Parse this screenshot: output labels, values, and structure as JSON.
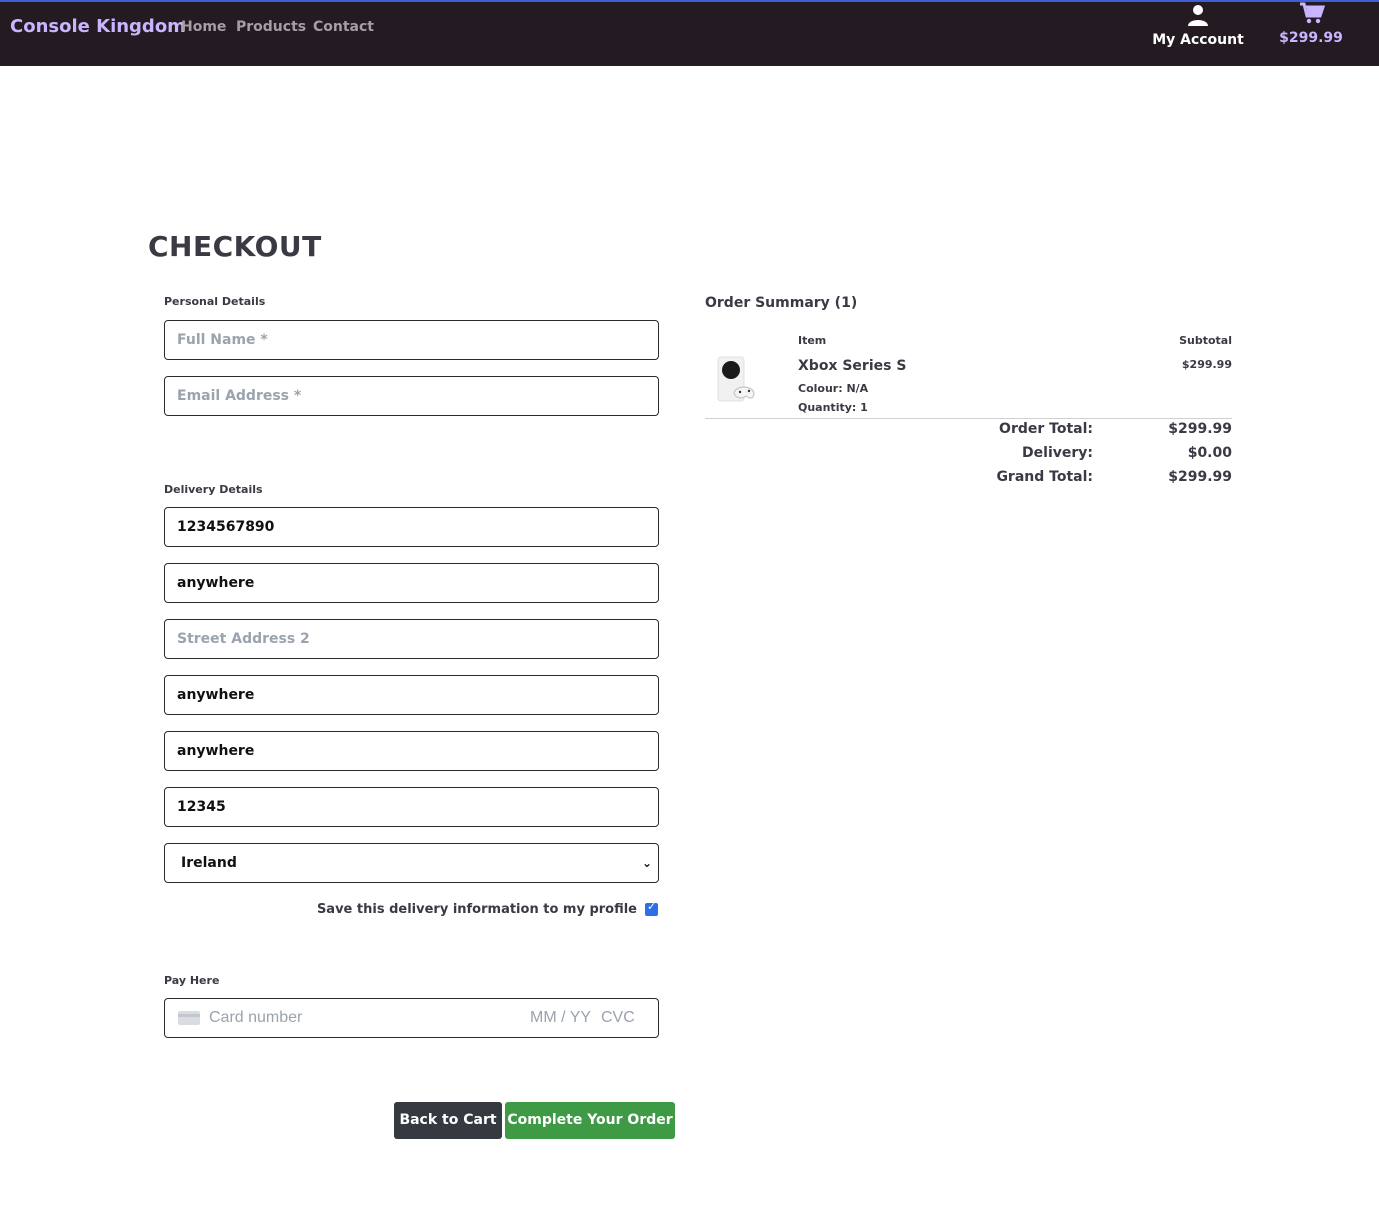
{
  "navbar": {
    "brand": "Console Kingdom",
    "links": [
      "Home",
      "Products",
      "Contact"
    ],
    "account_label": "My Account",
    "cart_total": "$299.99"
  },
  "page": {
    "title": "CHECKOUT"
  },
  "personal": {
    "section_label": "Personal Details",
    "full_name_placeholder": "Full Name *",
    "email_placeholder": "Email Address *"
  },
  "delivery": {
    "section_label": "Delivery Details",
    "phone": "1234567890",
    "street1": "anywhere",
    "street2_placeholder": "Street Address 2",
    "town": "anywhere",
    "county": "anywhere",
    "postcode": "12345",
    "country": "Ireland",
    "save_label": "Save this delivery information to my profile",
    "save_checked": true
  },
  "payment": {
    "section_label": "Pay Here",
    "card_placeholder": "Card number",
    "expiry_placeholder": "MM / YY",
    "cvc_placeholder": "CVC"
  },
  "buttons": {
    "back": "Back to Cart",
    "complete": "Complete Your Order"
  },
  "summary": {
    "title": "Order Summary (1)",
    "col_item": "Item",
    "col_subtotal": "Subtotal",
    "item": {
      "name": "Xbox Series S",
      "colour": "Colour: N/A",
      "quantity": "Quantity: 1",
      "subtotal": "$299.99"
    },
    "order_total_label": "Order Total:",
    "order_total": "$299.99",
    "delivery_label": "Delivery:",
    "delivery": "$0.00",
    "grand_total_label": "Grand Total:",
    "grand_total": "$299.99"
  },
  "colors": {
    "navbar_bg": "#231a22",
    "brand": "#c7b6ff",
    "back_button": "#343a40",
    "complete_button": "#3f9a45",
    "checkbox": "#2f6fe6"
  }
}
